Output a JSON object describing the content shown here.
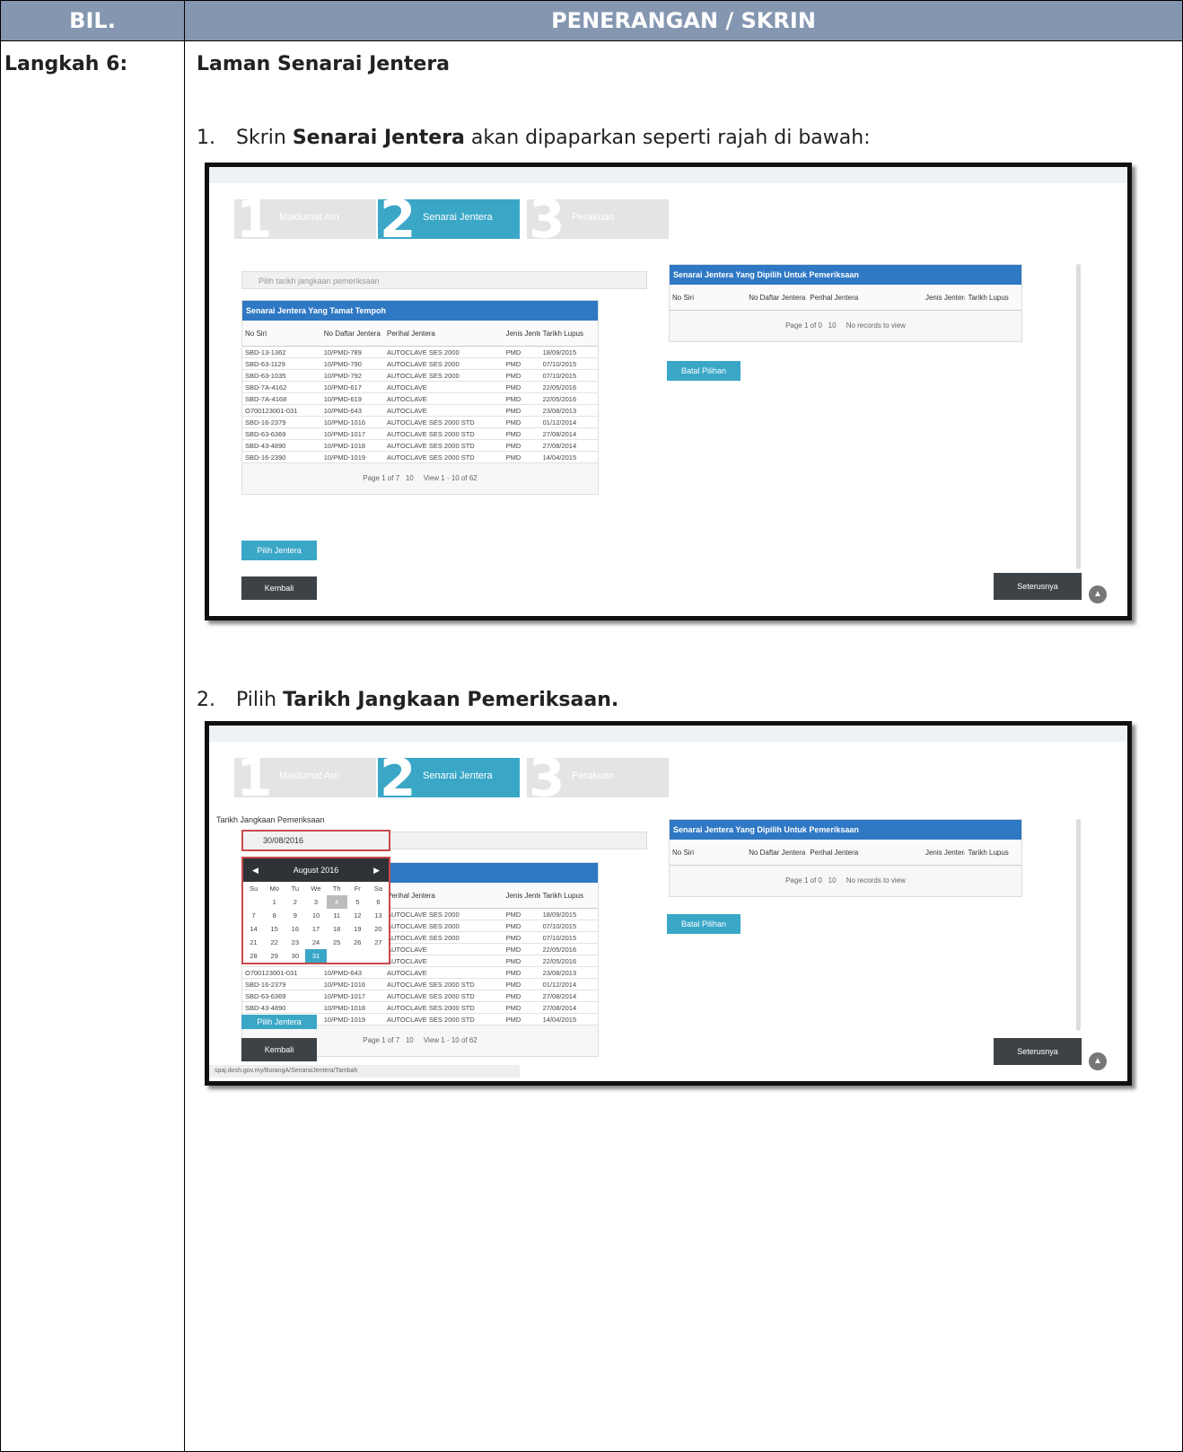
{
  "header": {
    "col1": "BIL.",
    "col2": "PENERANGAN / SKRIN"
  },
  "step_label": "Langkah 6:",
  "section_title": "Laman Senarai Jentera",
  "instructions": [
    {
      "num": "1.",
      "pre": "Skrin ",
      "bold": "Senarai Jentera",
      "post": " akan dipaparkan seperti rajah di bawah:"
    },
    {
      "num": "2.",
      "pre": "Pilih ",
      "bold": "Tarikh Jangkaan Pemeriksaan.",
      "post": ""
    }
  ],
  "screens": [
    {
      "wizard": [
        {
          "num": "1",
          "label": "Maklumat Am"
        },
        {
          "num": "2",
          "label": "Senarai Jentera"
        },
        {
          "num": "3",
          "label": "Perakuan"
        }
      ],
      "search_placeholder": "Pilih tarikh jangkaan pemeriksaan",
      "left_grid_title": "Senarai Jentera Yang Tamat Tempoh",
      "left_columns": [
        "No Siri",
        "No Daftar Jentera",
        "Perihal Jentera",
        "Jenis Jentera",
        "Tarikh Lupus"
      ],
      "rows": [
        [
          "SBD-13-1362",
          "10/PMD-789",
          "AUTOCLAVE SES 2000",
          "PMD",
          "18/09/2015"
        ],
        [
          "SBD-63-1129",
          "10/PMD-790",
          "AUTOCLAVE SES 2000",
          "PMD",
          "07/10/2015"
        ],
        [
          "SBD-63-1035",
          "10/PMD-792",
          "AUTOCLAVE SES 2000",
          "PMD",
          "07/10/2015"
        ],
        [
          "SBD-7A-4162",
          "10/PMD-617",
          "AUTOCLAVE",
          "PMD",
          "22/05/2016"
        ],
        [
          "SBD-7A-4168",
          "10/PMD-619",
          "AUTOCLAVE",
          "PMD",
          "22/05/2016"
        ],
        [
          "O700123001-031",
          "10/PMD-643",
          "AUTOCLAVE",
          "PMD",
          "23/08/2013"
        ],
        [
          "SBD-16-2379",
          "10/PMD-1016",
          "AUTOCLAVE SES 2000 STD",
          "PMD",
          "01/12/2014"
        ],
        [
          "SBD-63-6369",
          "10/PMD-1017",
          "AUTOCLAVE SES 2000 STD",
          "PMD",
          "27/08/2014"
        ],
        [
          "SBD-43-4890",
          "10/PMD-1018",
          "AUTOCLAVE SES 2000 STD",
          "PMD",
          "27/08/2014"
        ],
        [
          "SBD-16-2390",
          "10/PMD-1019",
          "AUTOCLAVE SES 2000 STD",
          "PMD",
          "14/04/2015"
        ]
      ],
      "left_pager": "Page 1 of 7",
      "left_pager_size": "10",
      "left_view": "View 1 - 10 of 62",
      "right_grid_title": "Senarai Jentera Yang Dipilih Untuk Pemeriksaan",
      "right_columns": [
        "No Siri",
        "No Daftar Jentera",
        "Perihal Jentera",
        "Jenis Jentera",
        "Tarikh Lupus"
      ],
      "right_pager": "Page 1 of 0",
      "right_pager_size": "10",
      "right_empty": "No records to view",
      "btn_batal": "Batal Pilihan",
      "btn_pilih": "Pilih Jentera",
      "btn_kembali": "Kembali",
      "btn_seterusnya": "Seterusnya"
    }
  ],
  "calendar": {
    "field_label": "Tarikh Jangkaan Pemeriksaan",
    "field_value": "30/08/2016",
    "month": "August 2016",
    "weekdays": [
      "Su",
      "Mo",
      "Tu",
      "We",
      "Th",
      "Fr",
      "Sa"
    ],
    "days": [
      "",
      "1",
      "2",
      "3",
      "4",
      "5",
      "6",
      "7",
      "8",
      "9",
      "10",
      "11",
      "12",
      "13",
      "14",
      "15",
      "16",
      "17",
      "18",
      "19",
      "20",
      "21",
      "22",
      "23",
      "24",
      "25",
      "26",
      "27",
      "28",
      "29",
      "30",
      "31"
    ],
    "today": "4",
    "selected": "31"
  },
  "status_url": "spaj.dosh.gov.my/BorangA/SenaraiJentera/Tambah"
}
